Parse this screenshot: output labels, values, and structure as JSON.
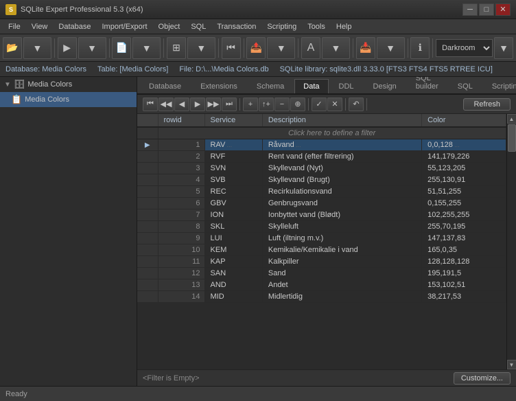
{
  "titlebar": {
    "icon": "🗃",
    "title": "SQLite Expert Professional 5.3 (x64)",
    "min": "─",
    "max": "□",
    "close": "✕"
  },
  "menu": {
    "items": [
      "File",
      "View",
      "Database",
      "Import/Export",
      "Object",
      "SQL",
      "Transaction",
      "Scripting",
      "Tools",
      "Help"
    ]
  },
  "infobar": {
    "database": "Database: Media Colors",
    "table": "Table: [Media Colors]",
    "file": "File: D:\\...\\Media Colors.db",
    "library": "SQLite library: sqlite3.dll 3.33.0 [FTS3 FTS4 FTS5 RTREE ICU]"
  },
  "sidebar": {
    "items": [
      {
        "label": "Media Colors",
        "level": 0,
        "icon": "🗄",
        "arrow": "▼"
      },
      {
        "label": "Media Colors",
        "level": 1,
        "icon": "📋"
      }
    ]
  },
  "tabs": {
    "items": [
      "Database",
      "Extensions",
      "Schema",
      "Data",
      "DDL",
      "Design",
      "SQL builder",
      "SQL",
      "Scripting"
    ],
    "active": "Data"
  },
  "toolbar": {
    "refresh_label": "Refresh"
  },
  "table": {
    "columns": [
      "rowid",
      "Service",
      "Description",
      "Color"
    ],
    "filter_placeholder": "Click here to define a filter",
    "rows": [
      {
        "rowid": 1,
        "service": "RAV",
        "description": "Råvand",
        "color": "0,0,128",
        "current": true
      },
      {
        "rowid": 2,
        "service": "RVF",
        "description": "Rent vand (efter filtrering)",
        "color": "141,179,226"
      },
      {
        "rowid": 3,
        "service": "SVN",
        "description": "Skyllevand (Nyt)",
        "color": "55,123,205"
      },
      {
        "rowid": 4,
        "service": "SVB",
        "description": "Skyllevand (Brugt)",
        "color": "255,130,91"
      },
      {
        "rowid": 5,
        "service": "REC",
        "description": "Recirkulationsvand",
        "color": "51,51,255"
      },
      {
        "rowid": 6,
        "service": "GBV",
        "description": "Genbrugsvand",
        "color": "0,155,255"
      },
      {
        "rowid": 7,
        "service": "ION",
        "description": "Ionbyttet vand (Blødt)",
        "color": "102,255,255"
      },
      {
        "rowid": 8,
        "service": "SKL",
        "description": "Skylleluft",
        "color": "255,70,195"
      },
      {
        "rowid": 9,
        "service": "LUI",
        "description": "Luft (iltning m.v.)",
        "color": "147,137,83"
      },
      {
        "rowid": 10,
        "service": "KEM",
        "description": "Kemikalie/Kemikalie i vand",
        "color": "165,0,35"
      },
      {
        "rowid": 11,
        "service": "KAP",
        "description": "Kalkpiller",
        "color": "128,128,128"
      },
      {
        "rowid": 12,
        "service": "SAN",
        "description": "Sand",
        "color": "195,191,5"
      },
      {
        "rowid": 13,
        "service": "AND",
        "description": "Andet",
        "color": "153,102,51"
      },
      {
        "rowid": 14,
        "service": "MID",
        "description": "Midlertidig",
        "color": "38,217,53"
      }
    ]
  },
  "filter": {
    "label": "<Filter is Empty>"
  },
  "footer": {
    "status": "Ready",
    "customize": "Customize..."
  }
}
